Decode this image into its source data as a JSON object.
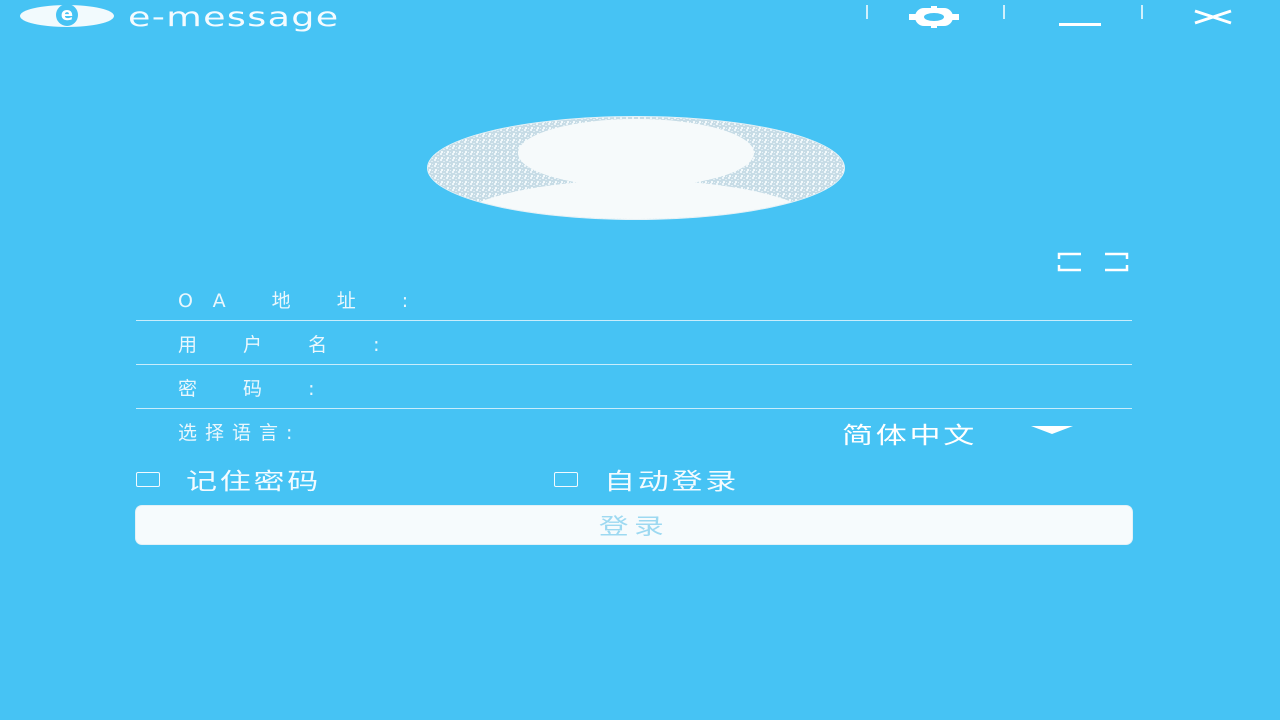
{
  "window": {
    "app_name": "e-message",
    "logo_letter": "e",
    "controls": {
      "settings_icon": "gear-icon",
      "minimize_icon": "minimize-icon",
      "close_icon": "close-icon"
    }
  },
  "avatar": {
    "icon": "user-silhouette-icon"
  },
  "expand_icon": "expand-icon",
  "form": {
    "oa_address": {
      "label": "OA 地 址 :",
      "value": "",
      "placeholder": ""
    },
    "username": {
      "label": "用 户 名 :",
      "value": "",
      "placeholder": ""
    },
    "password": {
      "label": "密   码  :",
      "value": "",
      "placeholder": ""
    },
    "language": {
      "label": "选择语言:",
      "selected": "简体中文"
    }
  },
  "options": {
    "remember_password": {
      "label": "记住密码",
      "checked": false
    },
    "auto_login": {
      "label": "自动登录",
      "checked": false
    }
  },
  "login_button": {
    "label": "登录"
  },
  "colors": {
    "background": "#46c3f4",
    "button_bg": "#f6fbfd",
    "button_text": "#9dd9f1",
    "text": "#ffffff"
  }
}
